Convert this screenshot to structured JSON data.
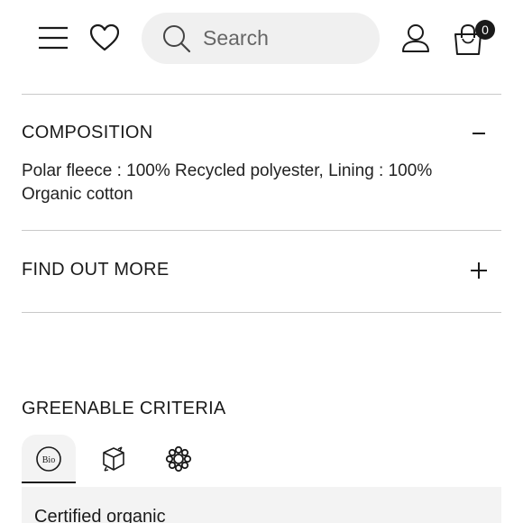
{
  "header": {
    "search": {
      "placeholder": "Search"
    },
    "cart": {
      "count": "0"
    },
    "icons": [
      "menu-icon",
      "heart-icon",
      "search-icon",
      "user-icon",
      "shopping-bag-icon"
    ]
  },
  "sections": {
    "composition": {
      "title": "COMPOSITION",
      "toggle": "collapse",
      "text": "Polar fleece : 100% Recycled polyester, Lining : 100% Organic cotton"
    },
    "find_out_more": {
      "title": "FIND OUT MORE",
      "toggle": "expand"
    }
  },
  "criteria": {
    "title": "GREENABLE CRITERIA",
    "tabs": [
      {
        "icon": "bio-badge-icon",
        "label": "Bio",
        "active": true
      },
      {
        "icon": "recycle-box-icon",
        "active": false
      },
      {
        "icon": "flower-icon",
        "active": false
      }
    ],
    "active_panel_title": "Certified organic"
  },
  "colors": {
    "text": "#1a1a1a",
    "divider": "#c9c9c9",
    "panel": "#f3f3f3",
    "search_bg": "#f0f0f0"
  }
}
